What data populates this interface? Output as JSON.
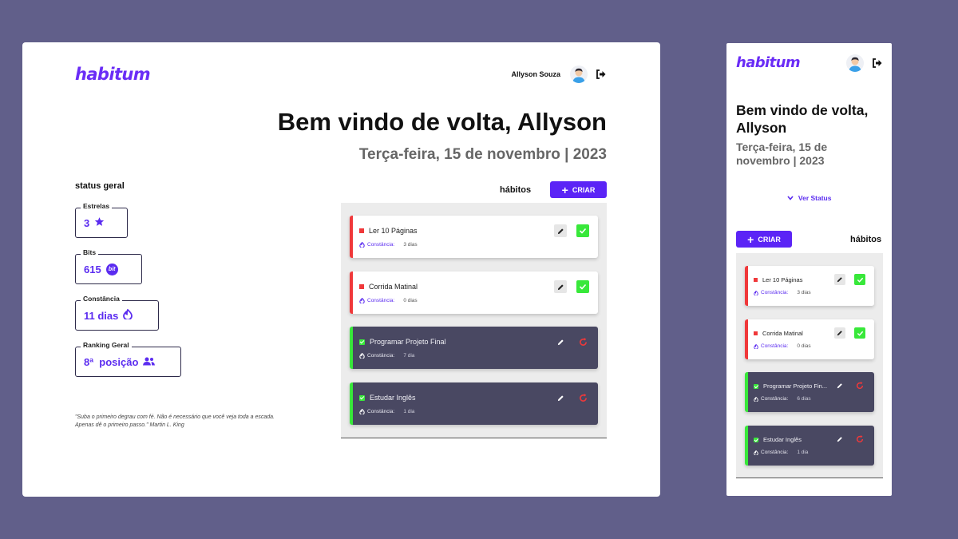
{
  "brand": {
    "name": "habitum",
    "accent": "#5b24f6"
  },
  "user": {
    "name": "Allyson Souza"
  },
  "welcome": "Bem vindo de volta, Allyson",
  "date": "Terça-feira, 15 de novembro | 2023",
  "status": {
    "title": "status geral",
    "cards": [
      {
        "label": "Estrelas",
        "value": "3",
        "icon": "star-icon"
      },
      {
        "label": "Bits",
        "value": "615",
        "icon": "bit-coin-icon",
        "icon_text": "bit"
      },
      {
        "label": "Constância",
        "value": "11 dias",
        "icon": "flame-icon"
      },
      {
        "label": "Ranking Geral",
        "value": "8ª  posição",
        "icon": "users-icon"
      }
    ]
  },
  "quote": "\"Suba o primeiro degrau com fé. Não é necessário que você veja toda a escada. Apenas dê o primeiro passo.\" Martin L. King",
  "habits_section": {
    "title": "hábitos",
    "create_label": "CRIAR"
  },
  "habits_desktop": [
    {
      "title": "Ler 10 Páginas",
      "status": "pending",
      "constancy_label": "Constância:",
      "days": "3 dias"
    },
    {
      "title": "Corrida Matinal",
      "status": "pending",
      "constancy_label": "Constância:",
      "days": "0 dias"
    },
    {
      "title": "Programar Projeto Final",
      "status": "done",
      "constancy_label": "Constância:",
      "days": "7 dia"
    },
    {
      "title": "Estudar Inglês",
      "status": "done",
      "constancy_label": "Constância:",
      "days": "1 dia"
    }
  ],
  "mobile": {
    "ver_status": "Ver Status",
    "habits": [
      {
        "title": "Ler 10 Páginas",
        "status": "pending",
        "constancy_label": "Constância:",
        "days": "3 dias"
      },
      {
        "title": "Corrida Matinal",
        "status": "pending",
        "constancy_label": "Constância:",
        "days": "0 dias"
      },
      {
        "title": "Programar Projeto Fin...",
        "status": "done",
        "constancy_label": "Constância:",
        "days": "6 dias"
      },
      {
        "title": "Estudar Inglês",
        "status": "done",
        "constancy_label": "Constância:",
        "days": "1 dia"
      }
    ]
  },
  "colors": {
    "background": "#615f8a",
    "pending": "#f0383a",
    "done": "#38e83a",
    "done_card": "#494862"
  }
}
